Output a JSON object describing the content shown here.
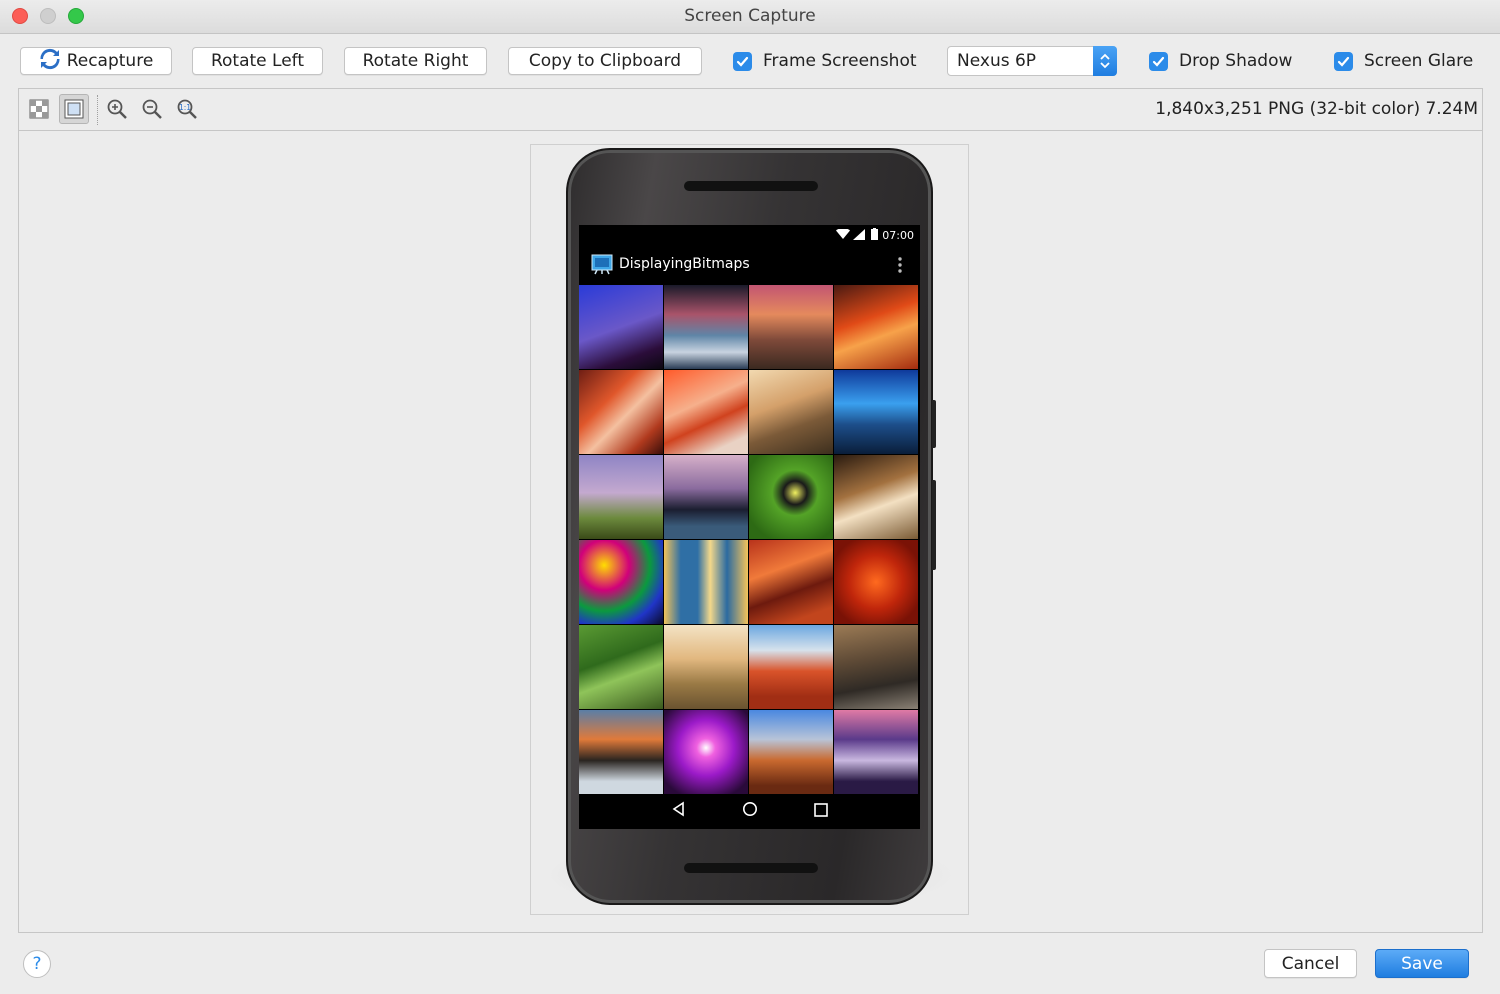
{
  "window": {
    "title": "Screen Capture"
  },
  "toolbar": {
    "recapture": "Recapture",
    "rotate_left": "Rotate Left",
    "rotate_right": "Rotate Right",
    "copy": "Copy to Clipboard",
    "frame_screenshot": {
      "label": "Frame Screenshot",
      "checked": true
    },
    "device": "Nexus 6P",
    "drop_shadow": {
      "label": "Drop Shadow",
      "checked": true
    },
    "screen_glare": {
      "label": "Screen Glare",
      "checked": true
    }
  },
  "subtoolbar": {
    "tools": [
      "checkerboard-icon",
      "frame-view-icon",
      "zoom-in-icon",
      "zoom-out-icon",
      "zoom-actual-icon"
    ],
    "image_info": "1,840x3,251 PNG (32-bit color) 7.24M"
  },
  "phone": {
    "status_time": "07:00",
    "app_title": "DisplayingBitmaps",
    "tiles": [
      "linear-gradient(160deg,#2a3bd8,#6a58c8 50%,#2b0d3a 80%,#0b0710)",
      "linear-gradient(180deg,#1a1a2a,#a9546a 35%,#5f85a7 60%,#c8d3e0 80%,#2a3d55)",
      "linear-gradient(180deg,#c25572,#e58a5d 35%,#7f4a3a 65%,#3b2920)",
      "linear-gradient(160deg,#4b1a12,#e04a17 40%,#f7a24a 60%,#a32b0f)",
      "linear-gradient(135deg,#6e1e14,#e0572b 35%,#f4c0a0 55%,#b13a1e 80%,#3a0e0a)",
      "linear-gradient(155deg,#ff5a2a,#f6b08c 40%,#d0421e 60%,#e9d2c4 85%)",
      "linear-gradient(160deg,#f2d9b0,#d4a06a 40%,#7b5a38 65%,#3d2f1e)",
      "linear-gradient(180deg,#0f3a9b,#3aa0ef 40%,#1d4e8a 65%,#0a1e3a)",
      "linear-gradient(180deg,#8f85c5,#c4a9cf 45%,#6c8a3d 75%,#3a4a18)",
      "linear-gradient(180deg,#d6b0c9,#8a6b9e 40%,#1b1e30 65%,#3a5b7a 85%)",
      "radial-gradient(circle at 55% 45%,#f0f060 0%,#1a1a1a 18%,#54a327 35%,#2d6a14 80%)",
      "linear-gradient(160deg,#2a1b10,#a3713f 40%,#f3e0c2 60%,#7a5a34)",
      "radial-gradient(circle at 30% 30%,#ffde00,#d1007a 30%,#0b9a3e 55%,#2035c8 75%,#0a0a2a)",
      "linear-gradient(90deg,#f2c35a,#2f6fa5 20%,#2f6fa5 40%,#f3d88a 55%,#2b6aa0 75%,#f5c45a)",
      "linear-gradient(160deg,#b8331b,#f07a3a 35%,#6d1a0e 60%,#c2451d 85%)",
      "radial-gradient(circle at 50% 50%,#ff6a1f,#c0260b 45%,#7a1206 80%)",
      "linear-gradient(160deg,#5a9a33,#2f6a1c 40%,#8fc45a 60%,#3a5a1e)",
      "linear-gradient(180deg,#f3e3c4,#e2b880 40%,#9a7a45 70%,#6a5330)",
      "linear-gradient(180deg,#6ba7e0,#d6e2ec 30%,#d9532a 55%,#a12e14 85%)",
      "linear-gradient(170deg,#9c7b55,#5e4a36 40%,#2f2a25 70%,#8a8175)",
      "linear-gradient(180deg,#5a7ea6,#e07a3a 35%,#2a2420 60%,#cfd8e0 85%)",
      "radial-gradient(circle at 50% 45%,#ffffff 0%,#f061e0 15%,#9b1ac8 45%,#2a0a3a 85%)",
      "linear-gradient(180deg,#4a88e0,#b8c4d8 35%,#c9692f 60%,#6a2a12 90%)",
      "linear-gradient(180deg,#e07aa5,#5a3a8a 35%,#c9b8e0 60%,#2a1a45 85%)"
    ]
  }
}
